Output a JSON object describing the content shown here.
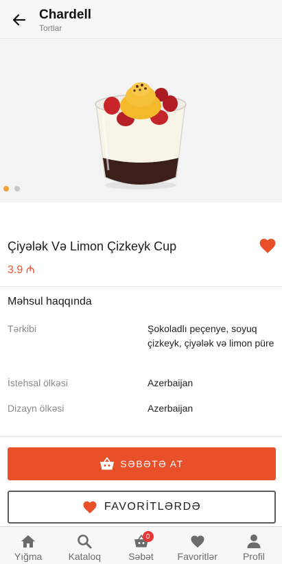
{
  "header": {
    "title": "Chardell",
    "subtitle": "Tortlar"
  },
  "product": {
    "name": "Çiyələk Və Limon Çizkeyk Cup",
    "price": "3.9 ₼",
    "favorited": true
  },
  "gallery": {
    "image_count": 2,
    "active_index": 0
  },
  "about": {
    "title": "Məhsul haqqında",
    "specs": [
      {
        "label": "Tərkibi",
        "value": "Şokoladlı peçenye, soyuq çizkeyk, çiyələk və limon püre"
      },
      {
        "label": "İstehsal ölkəsi",
        "value": "Azerbaijan"
      },
      {
        "label": "Dizayn ölkəsi",
        "value": "Azerbaijan"
      }
    ]
  },
  "actions": {
    "add_to_cart": "SƏBƏTƏ AT",
    "favorites": "FAVORİTLƏRDƏ"
  },
  "nav": {
    "items": [
      {
        "label": "Yığma",
        "icon": "home-icon"
      },
      {
        "label": "Kataloq",
        "icon": "search-icon"
      },
      {
        "label": "Səbət",
        "icon": "basket-icon",
        "badge": "0"
      },
      {
        "label": "Favoritlər",
        "icon": "heart-icon"
      },
      {
        "label": "Profil",
        "icon": "person-icon"
      }
    ]
  },
  "colors": {
    "accent": "#e8502a",
    "price": "#e8542b",
    "dot_active": "#f2a23a",
    "badge": "#e53935"
  }
}
